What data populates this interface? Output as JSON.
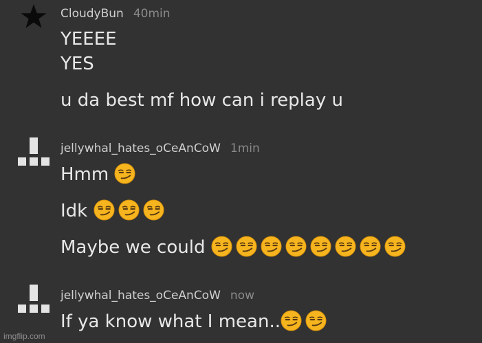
{
  "messages": [
    {
      "username": "CloudyBun",
      "time": "40min",
      "avatar_icon": "star-icon",
      "lines": [
        "YEEEE",
        "YES",
        "u da best mf how can i replay u"
      ]
    },
    {
      "username": "jellywhal_hates_oCeAnCoW",
      "time": "1min",
      "avatar_icon": "block-avatar-icon",
      "lines": [
        "Hmm",
        "Idk",
        "Maybe we could"
      ],
      "emoji": "smirking-face-emoji",
      "emoji_counts": [
        1,
        3,
        8
      ]
    },
    {
      "username": "jellywhal_hates_oCeAnCoW",
      "time": "now",
      "avatar_icon": "block-avatar-icon",
      "lines": [
        "If ya know what I mean.."
      ],
      "emoji": "smirking-face-emoji",
      "emoji_counts": [
        2
      ]
    }
  ],
  "watermark": "imgflip.com",
  "colors": {
    "background": "#323232",
    "username": "#cfcfcf",
    "timestamp": "#8a8a8a",
    "message_text": "#e8e8e8",
    "emoji_face": "#f4b400"
  }
}
